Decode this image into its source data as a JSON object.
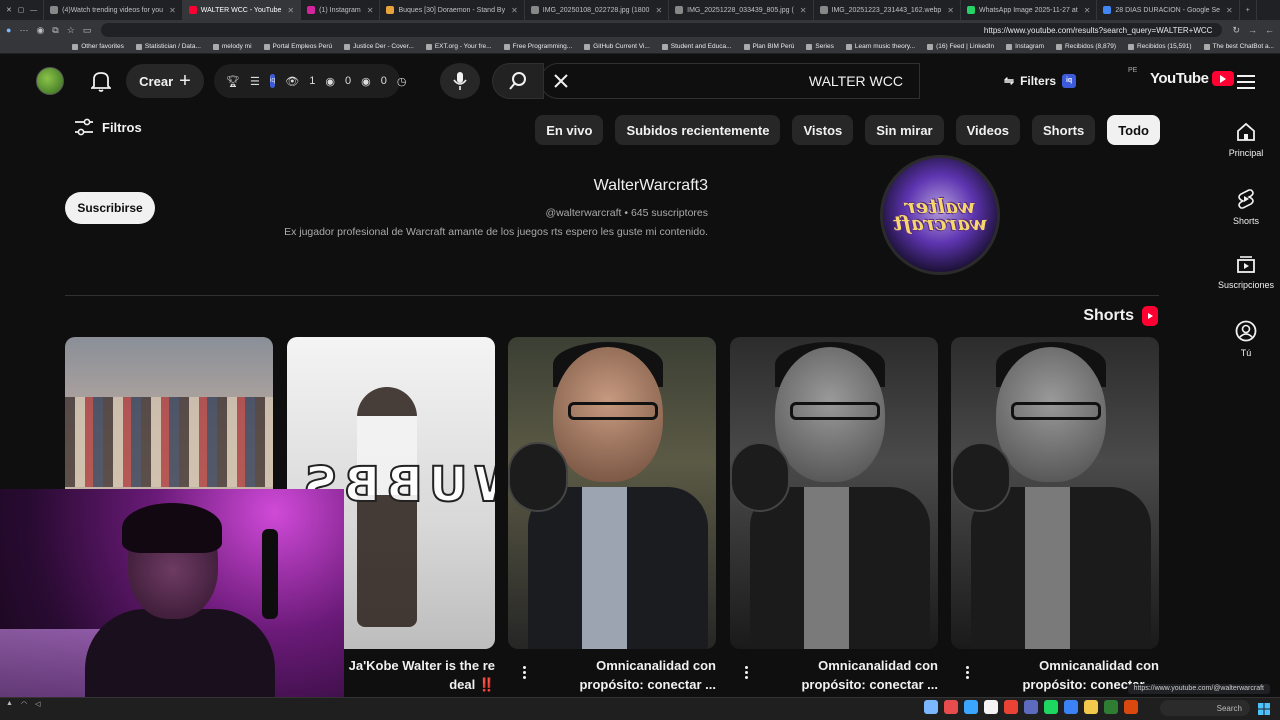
{
  "browser": {
    "tabs": [
      {
        "label": "(4)Watch trending videos for you",
        "active": false
      },
      {
        "label": "WALTER WCC - YouTube",
        "active": true
      },
      {
        "label": "(1) Instagram",
        "active": false
      },
      {
        "label": "Buques [30] Doraemon - Stand By",
        "active": false
      },
      {
        "label": "IMG_20250108_022728.jpg (1800",
        "active": false
      },
      {
        "label": "IMG_20251228_033439_805.jpg (",
        "active": false
      },
      {
        "label": "IMG_20251223_231443_162.webp",
        "active": false
      },
      {
        "label": "WhatsApp Image 2025-11-27 at",
        "active": false
      },
      {
        "label": "28 DIAS DURACION - Google Se",
        "active": false
      }
    ],
    "url": "https://www.youtube.com/results?search_query=WALTER+WCC",
    "bookmarks": [
      "The best ChatBot a...",
      "Recibidos (15,591)",
      "Recibidos (8,879)",
      "Instagram",
      "(16) Feed | LinkedIn",
      "Learn music theory...",
      "Series",
      "Plan BIM Perú",
      "Student and Educa...",
      "GitHub Current Vi...",
      "Free Programming...",
      "EXT.org - Your fre...",
      "Justice Der - Cover...",
      "Portal Empleos Perú",
      "melody mi",
      "Statistician / Data...",
      "Other favorites"
    ]
  },
  "youtube": {
    "logo_text": "YouTube",
    "country": "PE",
    "search_query": "WALTER WCC",
    "filters_label": "Filters",
    "create_label": "Crear",
    "ext_counts": {
      "a": "1",
      "b": "0",
      "c": "0"
    },
    "guide": [
      {
        "label": "Principal",
        "icon": "home-icon"
      },
      {
        "label": "Shorts",
        "icon": "shorts-icon"
      },
      {
        "label": "Suscripciones",
        "icon": "subscriptions-icon"
      },
      {
        "label": "Tú",
        "icon": "you-icon"
      }
    ],
    "chips": [
      {
        "label": "Todo",
        "selected": true
      },
      {
        "label": "Shorts",
        "selected": false
      },
      {
        "label": "Videos",
        "selected": false
      },
      {
        "label": "Sin mirar",
        "selected": false
      },
      {
        "label": "Vistos",
        "selected": false
      },
      {
        "label": "Subidos recientemente",
        "selected": false
      },
      {
        "label": "En vivo",
        "selected": false
      }
    ],
    "filtros_label": "Filtros",
    "channel": {
      "name": "WalterWarcraft3",
      "handle_meta": "@walterwarcraft • 645 suscriptores",
      "description": "Ex jugador profesional de Warcraft amante de los juegos rts espero les guste mi contenido.",
      "avatar_text": "walter warcraft",
      "subscribe_label": "Suscribirse"
    },
    "shorts_heading": "Shorts",
    "shorts": [
      {
        "title_line1": "Omnicanalidad con",
        "title_line2": "propósito: conectar ..."
      },
      {
        "title_line1": "Omnicanalidad con",
        "title_line2": "propósito: conectar ..."
      },
      {
        "title_line1": "Omnicanalidad con",
        "title_line2": "propósito: conectar ..."
      },
      {
        "title_line1": "Ja'Kobe Walter is the re",
        "title_line2": "deal ‼️"
      },
      {
        "title_line1": "",
        "title_line2": ""
      }
    ],
    "player_overlay_text": "WUBBS"
  },
  "status_url": "https://www.youtube.com/@walterwarcraft",
  "taskbar": {
    "search_label": "Search"
  },
  "colors": {
    "accent": "#ff0033",
    "bg": "#0f0f0f",
    "chip_bg": "#272727",
    "chip_selected": "#f1f1f1"
  }
}
